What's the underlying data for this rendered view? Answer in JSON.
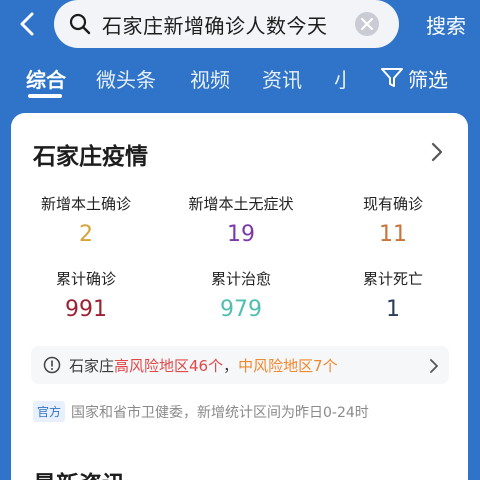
{
  "search": {
    "query": "石家庄新增确诊人数今天",
    "submit_label": "搜索"
  },
  "tabs": [
    {
      "label": "综合",
      "active": true
    },
    {
      "label": "微头条",
      "active": false
    },
    {
      "label": "视频",
      "active": false
    },
    {
      "label": "资讯",
      "active": false
    },
    {
      "label": "小",
      "active": false
    }
  ],
  "filter": {
    "label": "筛选",
    "icon": "filter-icon"
  },
  "card": {
    "title": "石家庄疫情",
    "stats_row1": [
      {
        "label": "新增本土确诊",
        "value": "2",
        "color": "#d8a23a"
      },
      {
        "label": "新增本土无症状",
        "value": "19",
        "color": "#7b3aa8"
      },
      {
        "label": "现有确诊",
        "value": "11",
        "color": "#c9743a"
      }
    ],
    "stats_row2": [
      {
        "label": "累计确诊",
        "value": "991",
        "color": "#9c2233"
      },
      {
        "label": "累计治愈",
        "value": "979",
        "color": "#4fbfb0"
      },
      {
        "label": "累计死亡",
        "value": "1",
        "color": "#2a3d5a"
      }
    ],
    "notice": {
      "prefix": "石家庄",
      "high_risk": "高风险地区46个",
      "separator": "，",
      "mid_risk": "中风险地区7个"
    },
    "source": {
      "badge": "官方",
      "text": "国家和省市卫健委，新增统计区间为昨日0-24时"
    },
    "next_section_title": "最新资讯"
  },
  "colors": {
    "background": "#2f74c8",
    "high_risk": "#e04848",
    "mid_risk": "#f0882e"
  }
}
